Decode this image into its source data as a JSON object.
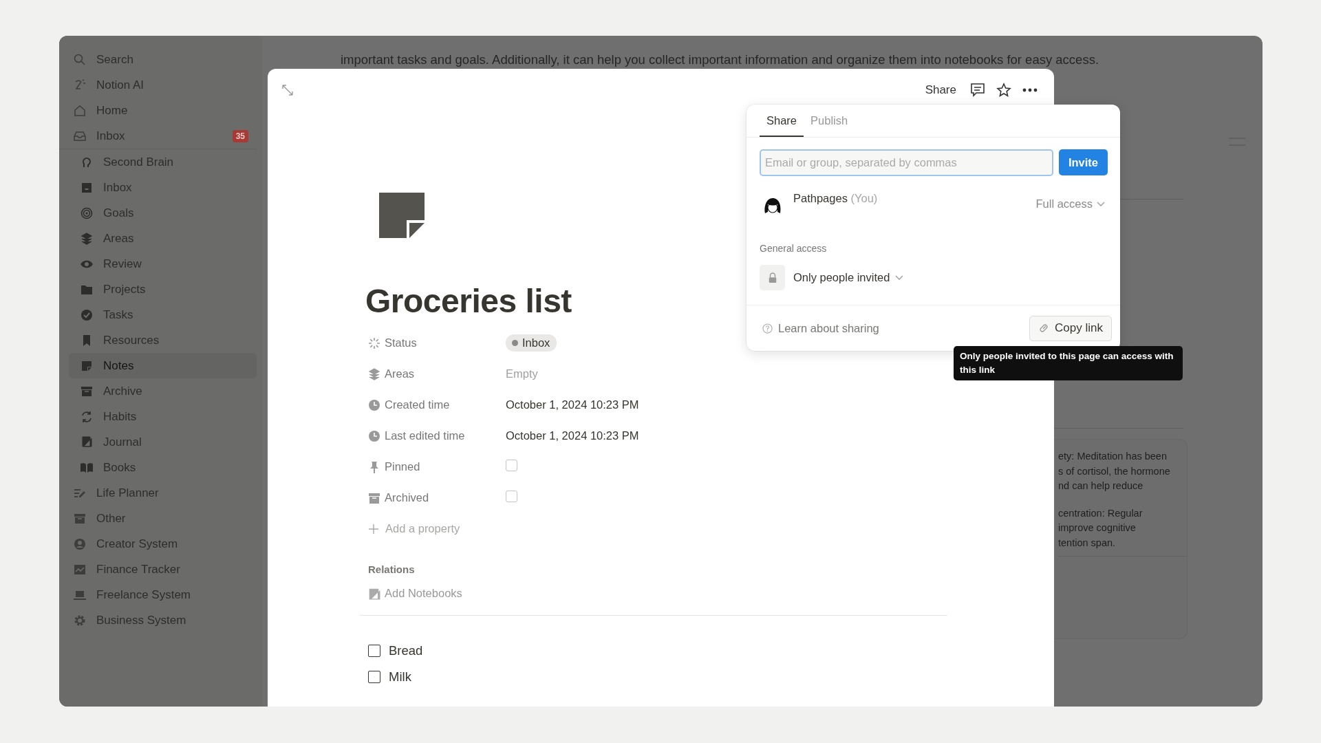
{
  "background": {
    "paragraph": "important tasks and goals. Additionally, it can help you collect important information and organize them into notebooks for easy access.",
    "side_card_paragraphs": [
      [
        "ety: Meditation has been",
        "s of cortisol, the hormone",
        "nd can help reduce"
      ],
      [
        "centration: Regular",
        "improve cognitive",
        "tention span."
      ]
    ]
  },
  "sidebar": {
    "items": [
      {
        "label": "Search",
        "selected": false
      },
      {
        "label": "Notion AI",
        "selected": false
      },
      {
        "label": "Home",
        "selected": false
      },
      {
        "label": "Inbox",
        "selected": false,
        "badge": "35"
      }
    ],
    "sub_pages": [
      {
        "label": "Second Brain",
        "selected": false
      },
      {
        "label": "Inbox",
        "selected": false
      },
      {
        "label": "Goals",
        "selected": false
      },
      {
        "label": "Areas",
        "selected": false
      },
      {
        "label": "Review",
        "selected": false
      },
      {
        "label": "Projects",
        "selected": false
      },
      {
        "label": "Tasks",
        "selected": false
      },
      {
        "label": "Resources",
        "selected": false
      },
      {
        "label": "Notes",
        "selected": true
      },
      {
        "label": "Archive",
        "selected": false
      },
      {
        "label": "Habits",
        "selected": false
      },
      {
        "label": "Journal",
        "selected": false
      },
      {
        "label": "Books",
        "selected": false
      }
    ],
    "pages": [
      {
        "label": "Life Planner",
        "selected": false
      },
      {
        "label": "Other",
        "selected": false
      },
      {
        "label": "Creator System",
        "selected": false
      },
      {
        "label": "Finance Tracker",
        "selected": false
      },
      {
        "label": "Freelance System",
        "selected": false
      },
      {
        "label": "Business System",
        "selected": false
      }
    ]
  },
  "modal": {
    "toolbar": {
      "share": "Share"
    },
    "title": "Groceries list",
    "properties": [
      {
        "label": "Status",
        "kind": "status",
        "value": "Inbox"
      },
      {
        "label": "Areas",
        "kind": "empty",
        "value": "Empty"
      },
      {
        "label": "Created time",
        "kind": "text",
        "value": "October 1, 2024 10:23 PM"
      },
      {
        "label": "Last edited time",
        "kind": "text",
        "value": "October 1, 2024 10:23 PM"
      },
      {
        "label": "Pinned",
        "kind": "checkbox",
        "checked": false
      },
      {
        "label": "Archived",
        "kind": "checkbox",
        "checked": false
      }
    ],
    "add_property": "Add a property",
    "relations": {
      "heading": "Relations",
      "add": "Add Notebooks"
    },
    "todos": [
      {
        "label": "Bread",
        "checked": false
      },
      {
        "label": "Milk",
        "checked": false
      }
    ]
  },
  "share_popup": {
    "tabs": [
      {
        "label": "Share",
        "selected": true
      },
      {
        "label": "Publish",
        "selected": false
      }
    ],
    "invite_field": {
      "placeholder": "Email or group, separated by commas"
    },
    "invite_button": "Invite",
    "member": {
      "name": "Pathpages",
      "note": "(You)",
      "access": "Full access"
    },
    "general_access": {
      "heading": "General access",
      "value": "Only people invited"
    },
    "learn": "Learn about sharing",
    "copy_link": "Copy link"
  },
  "tooltip": "Only people invited to this page can access with this link"
}
